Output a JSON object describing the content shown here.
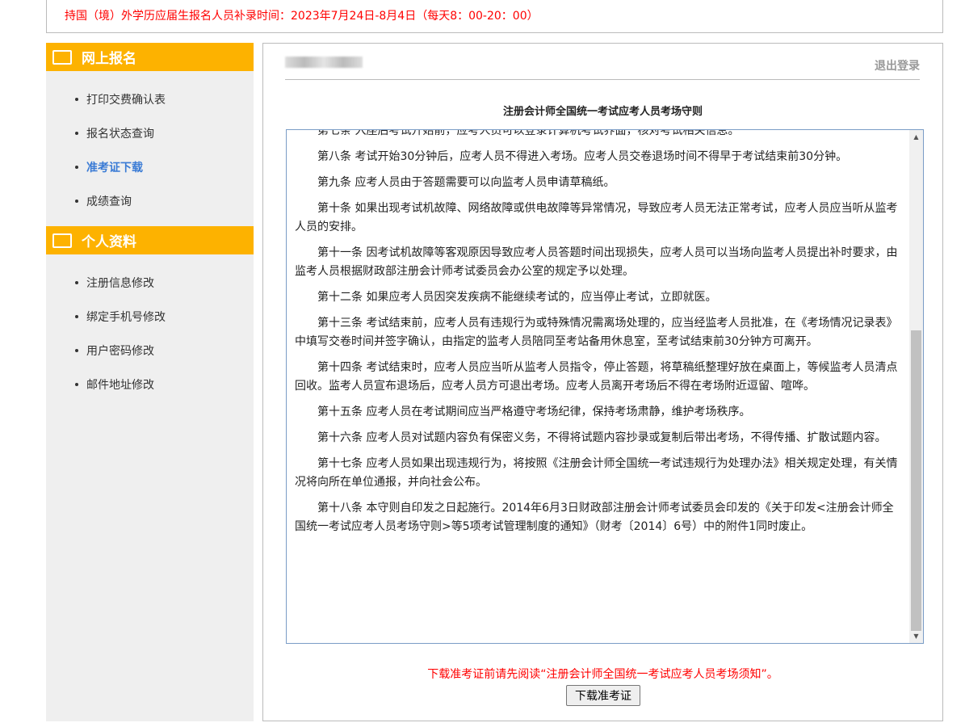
{
  "notice": "持国（境）外学历应届生报名人员补录时间：2023年7月24日-8月4日（每天8：00-20：00）",
  "sidebar": {
    "sections": [
      {
        "title": "网上报名",
        "icon": "monitor-icon",
        "items": [
          {
            "label": "打印交费确认表"
          },
          {
            "label": "报名状态查询"
          },
          {
            "label": "准考证下载",
            "active": true
          },
          {
            "label": "成绩查询"
          }
        ]
      },
      {
        "title": "个人资料",
        "icon": "id-card-icon",
        "items": [
          {
            "label": "注册信息修改"
          },
          {
            "label": "绑定手机号修改"
          },
          {
            "label": "用户密码修改"
          },
          {
            "label": "邮件地址修改"
          }
        ]
      }
    ]
  },
  "main": {
    "logout": "退出登录",
    "title": "注册会计师全国统一考试应考人员考场守则",
    "paragraphs": [
      "第七条 入座后考试开始前，应考人员可以登录计算机考试界面，核对考试相关信息。",
      "第八条 考试开始30分钟后，应考人员不得进入考场。应考人员交卷退场时间不得早于考试结束前30分钟。",
      "第九条 应考人员由于答题需要可以向监考人员申请草稿纸。",
      "第十条 如果出现考试机故障、网络故障或供电故障等异常情况，导致应考人员无法正常考试，应考人员应当听从监考人员的安排。",
      "第十一条 因考试机故障等客观原因导致应考人员答题时间出现损失，应考人员可以当场向监考人员提出补时要求，由监考人员根据财政部注册会计师考试委员会办公室的规定予以处理。",
      "第十二条 如果应考人员因突发疾病不能继续考试的，应当停止考试，立即就医。",
      "第十三条 考试结束前，应考人员有违规行为或特殊情况需离场处理的，应当经监考人员批准，在《考场情况记录表》中填写交卷时间并签字确认，由指定的监考人员陪同至考站备用休息室，至考试结束前30分钟方可离开。",
      "第十四条 考试结束时，应考人员应当听从监考人员指令，停止答题，将草稿纸整理好放在桌面上，等候监考人员清点回收。监考人员宣布退场后，应考人员方可退出考场。应考人员离开考场后不得在考场附近逗留、喧哗。",
      "第十五条 应考人员在考试期间应当严格遵守考场纪律，保持考场肃静，维护考场秩序。",
      "第十六条 应考人员对试题内容负有保密义务，不得将试题内容抄录或复制后带出考场，不得传播、扩散试题内容。",
      "第十七条 应考人员如果出现违规行为，将按照《注册会计师全国统一考试违规行为处理办法》相关规定处理，有关情况将向所在单位通报，并向社会公布。",
      "第十八条 本守则自印发之日起施行。2014年6月3日财政部注册会计师考试委员会印发的《关于印发<注册会计师全国统一考试应考人员考场守则>等5项考试管理制度的通知》（财考〔2014〕6号）中的附件1同时废止。"
    ],
    "warning": "下载准考证前请先阅读“注册会计师全国统一考试应考人员考场须知”。",
    "download": "下载准考证"
  },
  "colors": {
    "accent": "#fdb200",
    "notice": "#ff0000",
    "active": "#3a7bd5"
  }
}
